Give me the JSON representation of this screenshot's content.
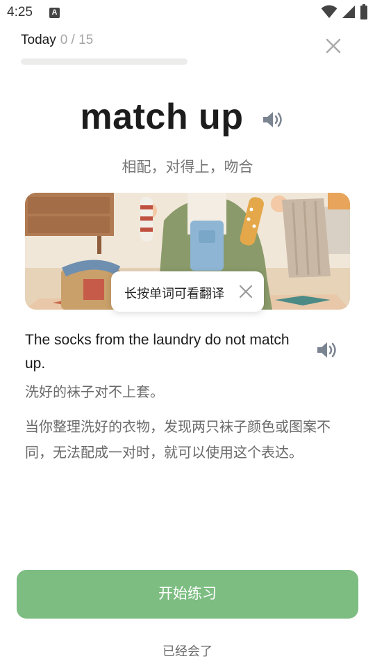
{
  "status_bar": {
    "time": "4:25",
    "notification_glyph": "A",
    "icons": [
      "wifi-icon",
      "signal-icon",
      "battery-icon"
    ]
  },
  "header": {
    "progress_label": "Today",
    "progress_count": "0 / 15",
    "progress_fraction": 0,
    "close_icon": "close-icon"
  },
  "word_card": {
    "word": "match up",
    "translation": "相配，对得上，吻合",
    "speaker_icon": "speaker-icon"
  },
  "illustration": {
    "icon": "illustration-image"
  },
  "tooltip": {
    "text": "长按单词可看翻译",
    "close_icon": "close-icon"
  },
  "example": {
    "sentence": "The socks from the laundry do not match up.",
    "translation": "洗好的袜子对不上套。",
    "explanation": "当你整理洗好的衣物，发现两只袜子颜色或图案不同，无法配成一对时，就可以使用这个表达。",
    "speaker_icon": "speaker-icon"
  },
  "actions": {
    "start_label": "开始练习",
    "known_label": "已经会了"
  },
  "colors": {
    "accent": "#7dbd82",
    "muted_text": "#6a6a6a",
    "progress_track": "#ececea"
  }
}
